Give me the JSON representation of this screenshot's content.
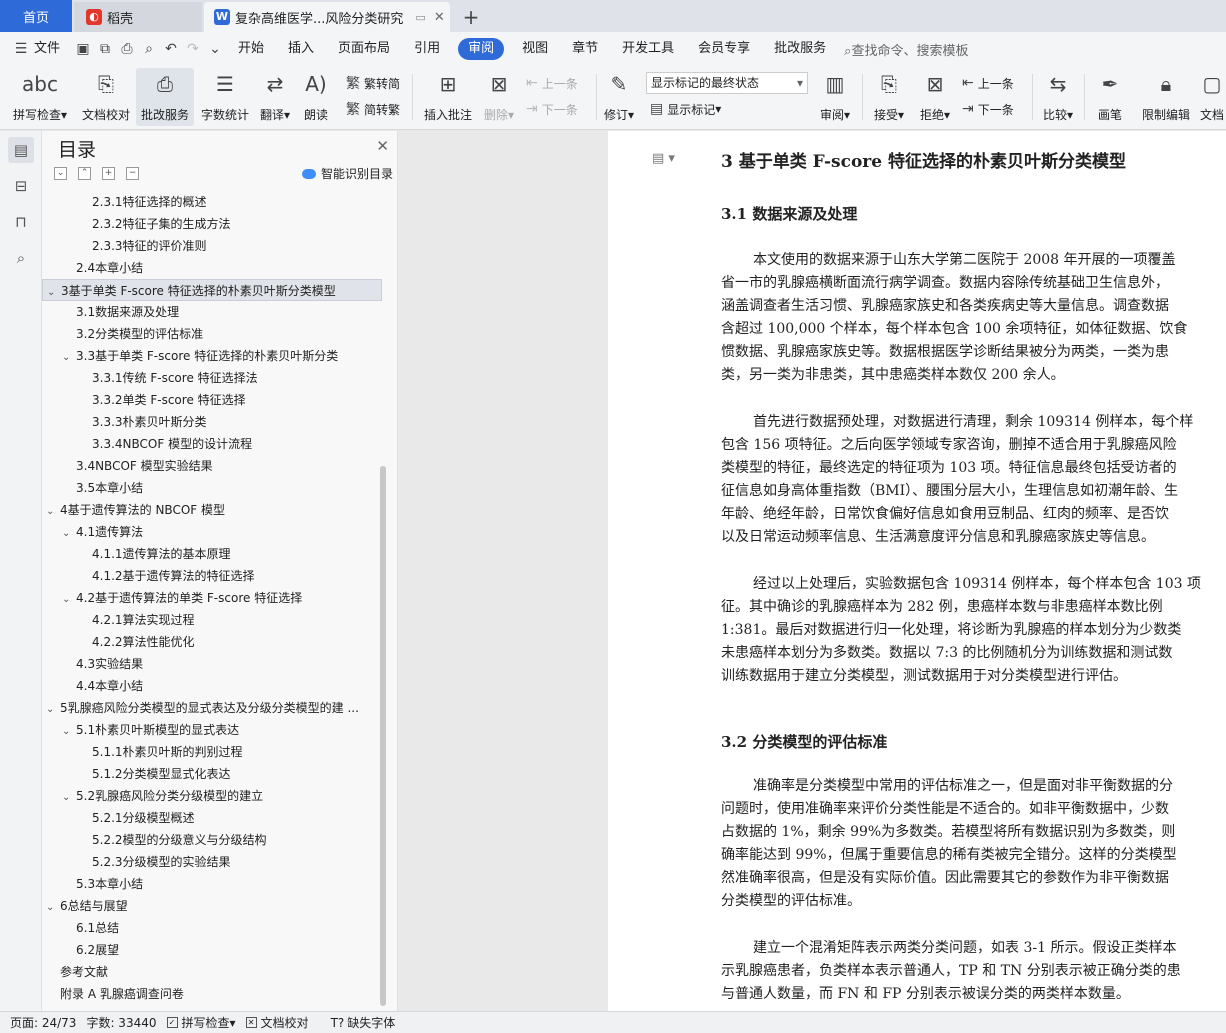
{
  "tabs": {
    "home": "首页",
    "docer": "稻壳",
    "doc": "复杂高维医学...风险分类研究",
    "plus": "+"
  },
  "menubar": {
    "file": "文件",
    "items": [
      "开始",
      "插入",
      "页面布局",
      "引用",
      "审阅",
      "视图",
      "章节",
      "开发工具",
      "会员专享",
      "批改服务"
    ],
    "active": "审阅",
    "search": "查找命令、搜索模板"
  },
  "ribbon": {
    "spell": "拼写检查",
    "proofread": "文档校对",
    "revise_service": "批改服务",
    "word_count": "字数统计",
    "translate": "翻译",
    "read_aloud": "朗读",
    "trad": "繁转简",
    "simp": "简转繁",
    "insert_comment": "插入批注",
    "delete": "删除",
    "prev_comment": "上一条",
    "next_comment": "下一条",
    "track": "修订",
    "markup_state": "显示标记的最终状态",
    "show_markup": "显示标记",
    "review": "审阅",
    "accept": "接受",
    "reject": "拒绝",
    "prev": "上一条",
    "next": "下一条",
    "compare": "比较",
    "pen": "画笔",
    "restrict": "限制编辑",
    "doc": "文档"
  },
  "toc": {
    "title": "目录",
    "smart": "智能识别目录",
    "items": [
      {
        "t": "2.3.1特征选择的概述",
        "lv": 3,
        "ch": ""
      },
      {
        "t": "2.3.2特征子集的生成方法",
        "lv": 3,
        "ch": ""
      },
      {
        "t": "2.3.3特征的评价准则",
        "lv": 3,
        "ch": ""
      },
      {
        "t": "2.4本章小结",
        "lv": 2,
        "ch": ""
      },
      {
        "t": "3基于单类 F-score 特征选择的朴素贝叶斯分类模型",
        "lv": 1,
        "ch": "v",
        "sel": true
      },
      {
        "t": "3.1数据来源及处理",
        "lv": 2,
        "ch": ""
      },
      {
        "t": "3.2分类模型的评估标准",
        "lv": 2,
        "ch": ""
      },
      {
        "t": "3.3基于单类 F-score 特征选择的朴素贝叶斯分类",
        "lv": 2,
        "ch": "v"
      },
      {
        "t": "3.3.1传统 F-score 特征选择法",
        "lv": 3,
        "ch": ""
      },
      {
        "t": "3.3.2单类 F-score 特征选择",
        "lv": 3,
        "ch": ""
      },
      {
        "t": "3.3.3朴素贝叶斯分类",
        "lv": 3,
        "ch": ""
      },
      {
        "t": "3.3.4NBCOF 模型的设计流程",
        "lv": 3,
        "ch": ""
      },
      {
        "t": "3.4NBCOF 模型实验结果",
        "lv": 2,
        "ch": ""
      },
      {
        "t": "3.5本章小结",
        "lv": 2,
        "ch": ""
      },
      {
        "t": "4基于遗传算法的 NBCOF 模型",
        "lv": 1,
        "ch": "v"
      },
      {
        "t": "4.1遗传算法",
        "lv": 2,
        "ch": "v"
      },
      {
        "t": "4.1.1遗传算法的基本原理",
        "lv": 3,
        "ch": ""
      },
      {
        "t": "4.1.2基于遗传算法的特征选择",
        "lv": 3,
        "ch": ""
      },
      {
        "t": "4.2基于遗传算法的单类 F-score 特征选择",
        "lv": 2,
        "ch": "v"
      },
      {
        "t": "4.2.1算法实现过程",
        "lv": 3,
        "ch": ""
      },
      {
        "t": "4.2.2算法性能优化",
        "lv": 3,
        "ch": ""
      },
      {
        "t": "4.3实验结果",
        "lv": 2,
        "ch": ""
      },
      {
        "t": "4.4本章小结",
        "lv": 2,
        "ch": ""
      },
      {
        "t": "5乳腺癌风险分类模型的显式表达及分级分类模型的建 ...",
        "lv": 1,
        "ch": "v"
      },
      {
        "t": "5.1朴素贝叶斯模型的显式表达",
        "lv": 2,
        "ch": "v"
      },
      {
        "t": "5.1.1朴素贝叶斯的判别过程",
        "lv": 3,
        "ch": ""
      },
      {
        "t": "5.1.2分类模型显式化表达",
        "lv": 3,
        "ch": ""
      },
      {
        "t": "5.2乳腺癌风险分类分级模型的建立",
        "lv": 2,
        "ch": "v"
      },
      {
        "t": "5.2.1分级模型概述",
        "lv": 3,
        "ch": ""
      },
      {
        "t": "5.2.2模型的分级意义与分级结构",
        "lv": 3,
        "ch": ""
      },
      {
        "t": "5.2.3分级模型的实验结果",
        "lv": 3,
        "ch": ""
      },
      {
        "t": "5.3本章小结",
        "lv": 2,
        "ch": ""
      },
      {
        "t": "6总结与展望",
        "lv": 1,
        "ch": "v"
      },
      {
        "t": "6.1总结",
        "lv": 2,
        "ch": ""
      },
      {
        "t": "6.2展望",
        "lv": 2,
        "ch": ""
      },
      {
        "t": "参考文献",
        "lv": 1,
        "ch": ""
      },
      {
        "t": "附录 A 乳腺癌调查问卷",
        "lv": 1,
        "ch": ""
      }
    ]
  },
  "doc": {
    "h1": "3  基于单类 F-score 特征选择的朴素贝叶斯分类模型",
    "h2a": "3.1  数据来源及处理",
    "p1": [
      "本文使用的数据来源于山东大学第二医院于 2008 年开展的一项覆盖",
      "省一市的乳腺癌横断面流行病学调查。数据内容除传统基础卫生信息外，",
      "涵盖调查者生活习惯、乳腺癌家族史和各类疾病史等大量信息。调查数据",
      "含超过 100,000 个样本，每个样本包含 100 余项特征，如体征数据、饮食",
      "惯数据、乳腺癌家族史等。数据根据医学诊断结果被分为两类，一类为患",
      "类，另一类为非患类，其中患癌类样本数仅 200 余人。"
    ],
    "p2": [
      "首先进行数据预处理，对数据进行清理，剩余 109314 例样本，每个样",
      "包含 156 项特征。之后向医学领域专家咨询，删掉不适合用于乳腺癌风险",
      "类模型的特征，最终选定的特征项为 103 项。特征信息最终包括受访者的",
      "征信息如身高体重指数（BMI）、腰围分层大小，生理信息如初潮年龄、生",
      "年龄、绝经年龄，日常饮食偏好信息如食用豆制品、红肉的频率、是否饮",
      "以及日常运动频率信息、生活满意度评分信息和乳腺癌家族史等信息。"
    ],
    "p3": [
      "经过以上处理后，实验数据包含 109314 例样本，每个样本包含 103 项",
      "征。其中确诊的乳腺癌样本为 282 例，患癌样本数与非患癌样本数比例",
      "1:381。最后对数据进行归一化处理，将诊断为乳腺癌的样本划分为少数类",
      "未患癌样本划分为多数类。数据以 7:3 的比例随机分为训练数据和测试数",
      "训练数据用于建立分类模型，测试数据用于对分类模型进行评估。"
    ],
    "h2b": "3.2  分类模型的评估标准",
    "p4": [
      "准确率是分类模型中常用的评估标准之一，但是面对非平衡数据的分",
      "问题时，使用准确率来评价分类性能是不适合的。如非平衡数据中，少数",
      "占数据的 1%，剩余 99%为多数类。若模型将所有数据识别为多数类，则",
      "确率能达到 99%，但属于重要信息的稀有类被完全错分。这样的分类模型",
      "然准确率很高，但是没有实际价值。因此需要其它的参数作为非平衡数据",
      "分类模型的评估标准。"
    ],
    "p5": [
      "建立一个混淆矩阵表示两类分类问题，如表 3-1 所示。假设正类样本",
      "示乳腺癌患者，负类样本表示普通人，TP 和 TN 分别表示被正确分类的患",
      "与普通人数量，而 FN 和 FP 分别表示被误分类的两类样本数量。"
    ]
  },
  "status": {
    "page": "页面: 24/73",
    "words": "字数: 33440",
    "spell": "拼写检查",
    "proof": "文档校对",
    "font": "缺失字体"
  }
}
